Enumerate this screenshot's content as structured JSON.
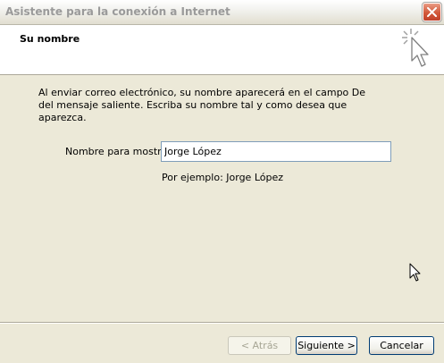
{
  "window": {
    "title": "Asistente para la conexión a Internet"
  },
  "header": {
    "title": "Su nombre"
  },
  "body": {
    "description": "Al enviar correo electrónico, su nombre aparecerá en el campo De del mensaje saliente. Escriba su nombre tal y como desea que aparezca.",
    "field_label": "Nombre para mostrar:",
    "field_value": "Jorge López",
    "example": "Por ejemplo: Jorge López"
  },
  "buttons": {
    "back": "< Atrás",
    "next": "Siguiente >",
    "cancel": "Cancelar"
  },
  "icons": {
    "close": "close-icon",
    "wizard": "wizard-cursor-icon",
    "cursor": "mouse-pointer-icon"
  },
  "colors": {
    "close_button": "#d2583a",
    "dialog_background": "#ece9d8",
    "input_border": "#7f9db9"
  }
}
